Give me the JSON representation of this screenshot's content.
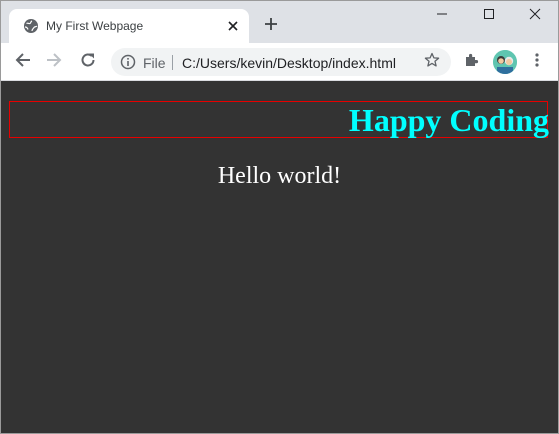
{
  "browser": {
    "tab": {
      "title": "My First Webpage"
    },
    "omnibox": {
      "scheme_label": "File",
      "url": "C:/Users/kevin/Desktop/index.html"
    },
    "icons": {
      "favicon": "globe-icon",
      "tab_close": "close-icon",
      "new_tab": "plus-icon",
      "minimize": "minimize-icon",
      "maximize": "maximize-icon",
      "window_close": "close-icon",
      "back": "arrow-left-icon",
      "forward": "arrow-right-icon",
      "reload": "reload-icon",
      "site_info": "info-icon",
      "bookmark": "star-icon",
      "extensions": "puzzle-icon",
      "profile": "avatar-icon",
      "menu": "more-vert-icon"
    }
  },
  "page": {
    "header_text": "Happy Coding",
    "body_text": "Hello world!"
  },
  "colors": {
    "page_background": "#333333",
    "header_text": "#00ffff",
    "header_border": "#e60000",
    "body_text": "#ffffff",
    "tabstrip": "#dee1e6"
  }
}
